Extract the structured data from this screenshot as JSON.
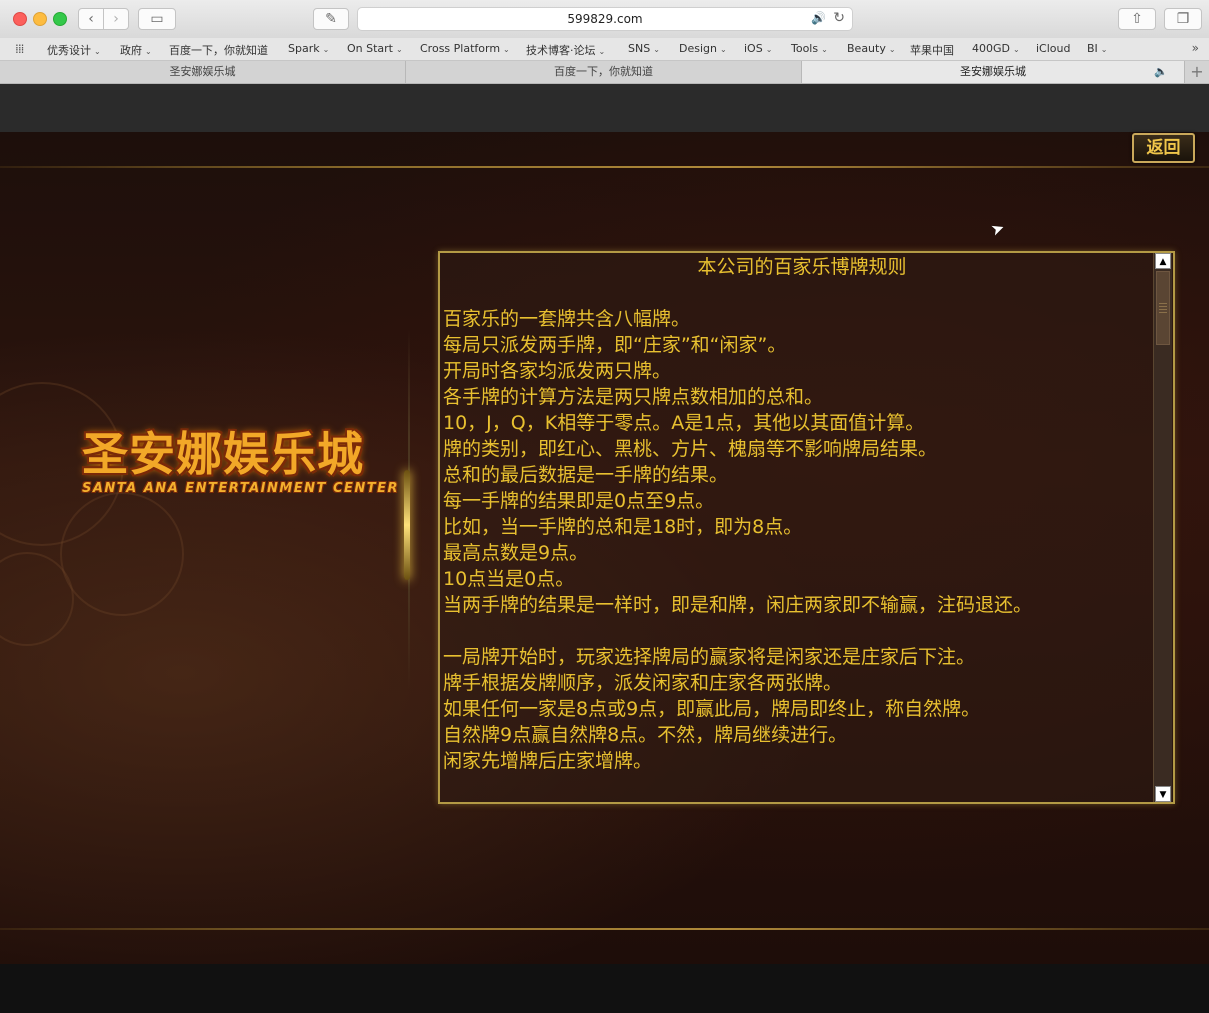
{
  "browser": {
    "url": "599829.com",
    "bookmarks": [
      {
        "label": "优秀设计",
        "dropdown": true
      },
      {
        "label": "政府",
        "dropdown": true
      },
      {
        "label": "百度一下，你就知道",
        "dropdown": false
      },
      {
        "label": "Spark",
        "dropdown": true
      },
      {
        "label": "On Start",
        "dropdown": true
      },
      {
        "label": "Cross Platform",
        "dropdown": true
      },
      {
        "label": "技术博客·论坛",
        "dropdown": true
      },
      {
        "label": "SNS",
        "dropdown": true
      },
      {
        "label": "Design",
        "dropdown": true
      },
      {
        "label": "iOS",
        "dropdown": true
      },
      {
        "label": "Tools",
        "dropdown": true
      },
      {
        "label": "Beauty",
        "dropdown": true
      },
      {
        "label": "苹果中国",
        "dropdown": false
      },
      {
        "label": "400GD",
        "dropdown": true
      },
      {
        "label": "iCloud",
        "dropdown": false
      },
      {
        "label": "BI",
        "dropdown": true
      }
    ],
    "tabs": [
      {
        "title": "圣安娜娱乐城",
        "active": false
      },
      {
        "title": "百度一下，你就知道",
        "active": false
      },
      {
        "title": "圣安娜娱乐城",
        "active": true
      }
    ]
  },
  "page": {
    "back_button": "返回",
    "logo": {
      "title": "圣安娜娱乐城",
      "subtitle": "SANTA ANA ENTERTAINMENT CENTER"
    },
    "rules": {
      "title": "本公司的百家乐博牌规则",
      "lines": [
        "",
        "百家乐的一套牌共含八幅牌。",
        "每局只派发两手牌，即“庄家”和“闲家”。",
        "开局时各家均派发两只牌。",
        "各手牌的计算方法是两只牌点数相加的总和。",
        "10，J，Q，K相等于零点。A是1点，其他以其面值计算。",
        "牌的类别，即红心、黑桃、方片、槐扇等不影响牌局结果。",
        "总和的最后数据是一手牌的结果。",
        "每一手牌的结果即是0点至9点。",
        "比如，当一手牌的总和是18时，即为8点。",
        "最高点数是9点。",
        "10点当是0点。",
        "当两手牌的结果是一样时，即是和牌，闲庄两家即不输赢，注码退还。",
        "",
        "一局牌开始时，玩家选择牌局的赢家将是闲家还是庄家后下注。",
        "牌手根据发牌顺序，派发闲家和庄家各两张牌。",
        "如果任何一家是8点或9点，即赢此局，牌局即终止，称自然牌。",
        "自然牌9点赢自然牌8点。不然，牌局继续进行。",
        "闲家先增牌后庄家增牌。"
      ]
    }
  },
  "colors": {
    "gold_text": "#e8c030",
    "panel_border": "#b39a45",
    "background": "#1d0f0b"
  }
}
